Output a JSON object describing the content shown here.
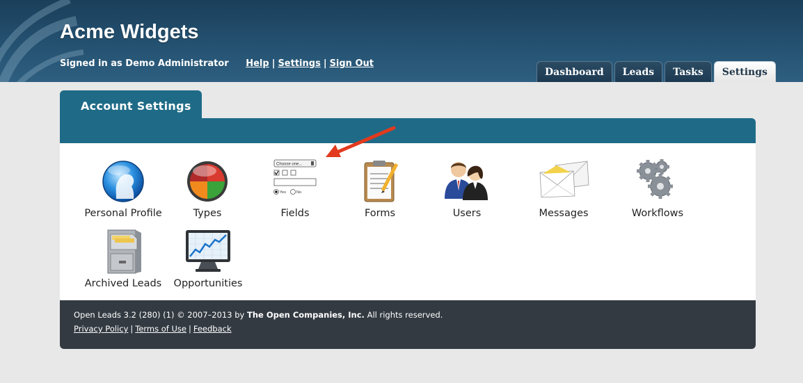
{
  "header": {
    "title": "Acme Widgets",
    "signed_in": "Signed in as Demo Administrator",
    "links": [
      "Help",
      "Settings",
      "Sign Out"
    ],
    "separator": "|"
  },
  "nav_tabs": [
    {
      "label": "Dashboard",
      "active": false
    },
    {
      "label": "Leads",
      "active": false
    },
    {
      "label": "Tasks",
      "active": false
    },
    {
      "label": "Settings",
      "active": true
    }
  ],
  "panel": {
    "title": "Account Settings",
    "items": [
      {
        "label": "Personal Profile",
        "icon": "personal-profile-icon"
      },
      {
        "label": "Types",
        "icon": "types-icon"
      },
      {
        "label": "Fields",
        "icon": "fields-icon"
      },
      {
        "label": "Forms",
        "icon": "forms-icon"
      },
      {
        "label": "Users",
        "icon": "users-icon"
      },
      {
        "label": "Messages",
        "icon": "messages-icon"
      },
      {
        "label": "Workflows",
        "icon": "workflows-icon"
      },
      {
        "label": "Archived Leads",
        "icon": "archived-leads-icon"
      },
      {
        "label": "Opportunities",
        "icon": "opportunities-icon"
      }
    ],
    "fields_icon_text": {
      "select": "Choose one...",
      "yes": "Yes",
      "no": "No"
    }
  },
  "footer": {
    "version": "Open Leads 3.2 (280) (1) © 2007–2013 by",
    "company": "The Open Companies, Inc.",
    "rights": "All rights reserved.",
    "links": [
      "Privacy Policy",
      "Terms of Use",
      "Feedback"
    ],
    "separator": "|"
  },
  "colors": {
    "header_bg": "#1f4662",
    "panel_teal": "#1f6b87",
    "footer_bg": "#333a42",
    "page_bg": "#e8e8e8",
    "arrow": "#e23a1e"
  }
}
